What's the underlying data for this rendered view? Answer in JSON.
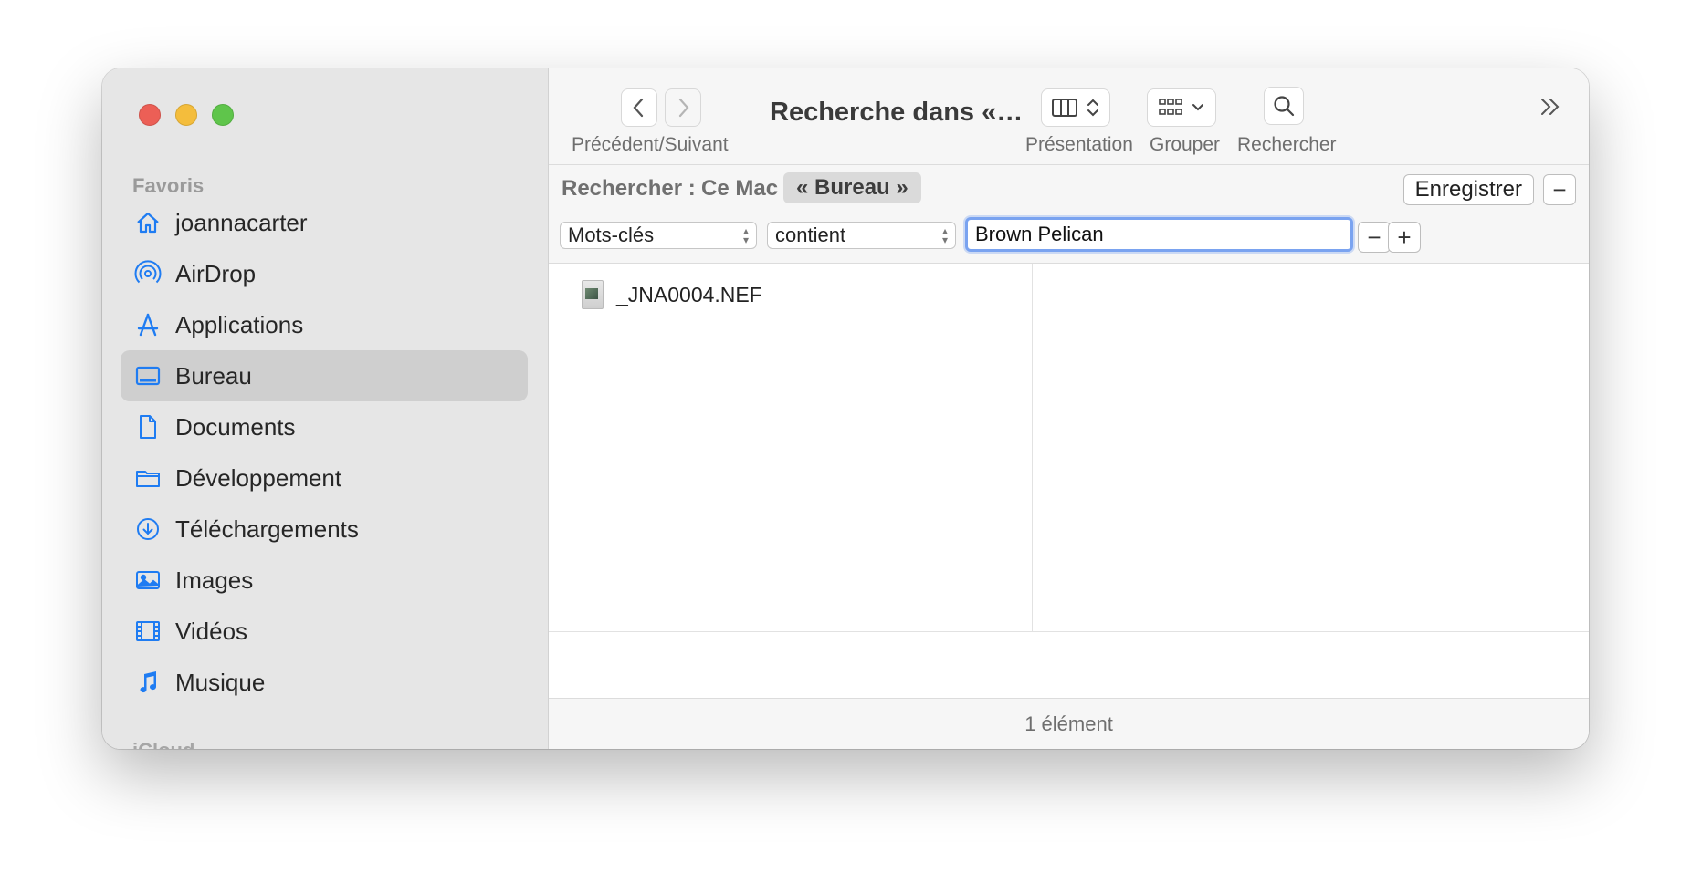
{
  "sidebar": {
    "section_label": "Favoris",
    "items": [
      {
        "label": "joannacarter",
        "icon": "home-icon"
      },
      {
        "label": "AirDrop",
        "icon": "airdrop-icon"
      },
      {
        "label": "Applications",
        "icon": "applications-icon"
      },
      {
        "label": "Bureau",
        "icon": "desktop-icon",
        "selected": true
      },
      {
        "label": "Documents",
        "icon": "document-icon"
      },
      {
        "label": "Développement",
        "icon": "folder-icon"
      },
      {
        "label": "Téléchargements",
        "icon": "download-icon"
      },
      {
        "label": "Images",
        "icon": "photo-icon"
      },
      {
        "label": "Vidéos",
        "icon": "film-icon"
      },
      {
        "label": "Musique",
        "icon": "music-icon"
      }
    ],
    "next_section_label": "iCloud"
  },
  "toolbar": {
    "nav_caption": "Précédent/Suivant",
    "title": "Recherche dans «…",
    "view_caption": "Présentation",
    "group_caption": "Grouper",
    "search_caption": "Rechercher"
  },
  "scope": {
    "label": "Rechercher :",
    "this_mac": "Ce Mac",
    "current": "« Bureau »",
    "save_label": "Enregistrer",
    "minus": "−"
  },
  "criteria": {
    "attribute": "Mots-clés",
    "operator": "contient",
    "value": "Brown Pelican",
    "minus": "−",
    "plus": "+"
  },
  "results": {
    "files": [
      {
        "name": "_JNA0004.NEF"
      }
    ]
  },
  "status": {
    "count_text": "1 élément"
  },
  "colors": {
    "accent": "#1f7cf2",
    "close": "#ec5f56",
    "minimize": "#f4bd3c",
    "maximize": "#5fc54b"
  }
}
